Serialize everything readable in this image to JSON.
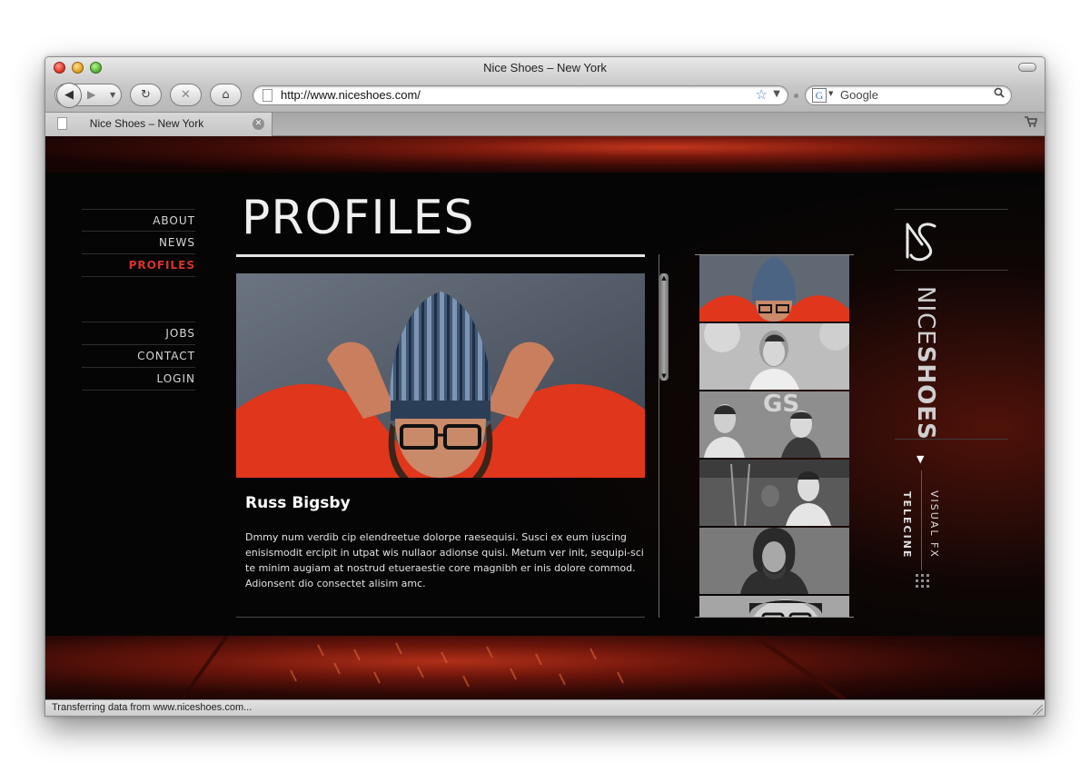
{
  "browser": {
    "window_title": "Nice Shoes – New York",
    "url": "http://www.niceshoes.com/",
    "search_placeholder": "Google",
    "search_engine_glyph": "G",
    "tab_title": "Nice Shoes – New York",
    "status_text": "Transferring data from www.niceshoes.com...",
    "icons": {
      "back": "◀",
      "forward": "▶",
      "history_menu": "▼",
      "reload": "↻",
      "stop": "✕",
      "home": "⌂",
      "bookmark": "☆",
      "url_menu": "▼",
      "search": "⚲",
      "tab_close": "✕",
      "cart": "🛒"
    }
  },
  "site": {
    "nav_top": [
      "ABOUT",
      "NEWS",
      "PROFILES"
    ],
    "nav_bottom": [
      "JOBS",
      "CONTACT",
      "LOGIN"
    ],
    "active_nav": "PROFILES",
    "heading": "PROFILES",
    "profile": {
      "name": "Russ Bigsby",
      "bio": "Dmmy num verdib cip elendreetue dolorpe raesequisi. Susci ex eum iuscing enisismodit ercipit in utpat wis nullaor adionse quisi. Metum ver init, sequipi-sci te minim augiam at nostrud etueraestie core magnibh er inis dolore commod. Adionsent dio consectet alisim amc."
    },
    "scroll_up": "▲",
    "scroll_down": "▼",
    "brand": {
      "logo_glyph": "NS",
      "word_light": "NICE",
      "word_bold": "SHOES",
      "arrow": "▼",
      "label_right": "VISUAL FX",
      "label_left": "TELECINE"
    },
    "colors": {
      "accent": "#d8332c",
      "background": "#050505",
      "band": "#7c1a0e"
    }
  }
}
